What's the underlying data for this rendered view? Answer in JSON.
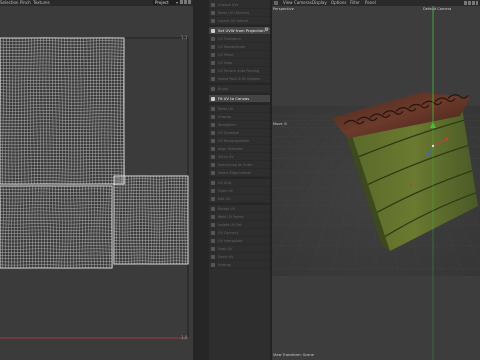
{
  "uv_editor": {
    "menu": [
      "Selection",
      "Pinch",
      "Textures"
    ],
    "mode_select": "Project",
    "coords": {
      "top_right": "1,1",
      "bottom_right": "1,0"
    }
  },
  "tools": {
    "items": [
      {
        "label": "Unpack UVs",
        "active": false
      },
      {
        "label": "Relax UV (Stretch)",
        "active": false
      },
      {
        "label": "Layout UV Islands",
        "active": false
      },
      {
        "label": "Set UVW from Projection",
        "active": true,
        "gear": true
      },
      {
        "label": "UV Transform",
        "active": false
      },
      {
        "label": "UV Rotate/Scale",
        "active": false
      },
      {
        "label": "UV Mirror",
        "active": false
      },
      {
        "label": "UV Snap",
        "active": false
      },
      {
        "label": "UV Terrace Auto Packing",
        "active": false
      },
      {
        "label": "Island Pack & Fit Options",
        "active": false
      },
      {
        "label": "Brush",
        "active": false
      },
      {
        "label": "Fit UV to Canvas",
        "active": true
      },
      {
        "label": "Relax UV",
        "active": false
      },
      {
        "label": "Unwrap",
        "active": false
      },
      {
        "label": "Straighten",
        "active": false
      },
      {
        "label": "UV Quantize",
        "active": false
      },
      {
        "label": "UV Rectangularize",
        "active": false
      },
      {
        "label": "Align Selection",
        "active": false
      },
      {
        "label": "Stitch UV",
        "active": false
      },
      {
        "label": "Seam/Loop to Order",
        "active": false
      },
      {
        "label": "Select Edge Islands",
        "active": false
      },
      {
        "label": "UV Grid",
        "active": false
      },
      {
        "label": "Open UV",
        "active": false
      },
      {
        "label": "Edit UV",
        "active": false
      },
      {
        "label": "Rotate UV",
        "active": false
      },
      {
        "label": "Weld UV Points",
        "active": false
      },
      {
        "label": "Isolate UV Set",
        "active": false
      },
      {
        "label": "UV Connect",
        "active": false
      },
      {
        "label": "UV Interpolate",
        "active": false
      },
      {
        "label": "Snap UV",
        "active": false
      },
      {
        "label": "Decal UV",
        "active": false
      },
      {
        "label": "Unwrap",
        "active": false
      }
    ]
  },
  "viewport": {
    "menu": [
      "View",
      "Cameras",
      "Display",
      "Options",
      "Filter",
      "Panel"
    ],
    "view_name": "Perspective",
    "camera": "Default Camera",
    "zoom_label": "Move",
    "footer": "View Transform: Scene",
    "colors": {
      "x_axis": "#d43a3a",
      "y_axis": "#3ac43a",
      "z_axis": "#3a6ad4"
    }
  }
}
